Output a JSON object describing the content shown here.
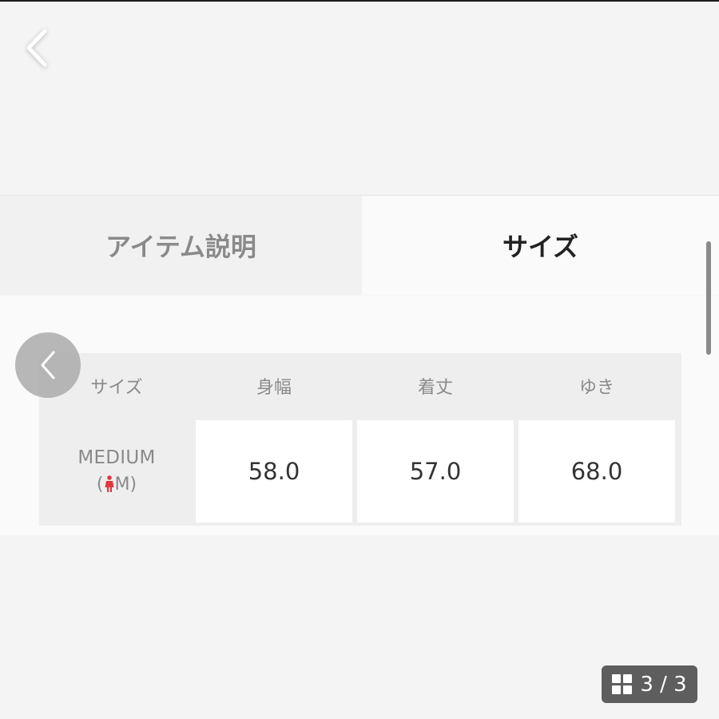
{
  "nav": {
    "back_icon": "chevron-left-icon"
  },
  "tabs": [
    {
      "label": "アイテム説明",
      "active": false
    },
    {
      "label": "サイズ",
      "active": true
    }
  ],
  "size_table": {
    "headers": [
      "サイズ",
      "身幅",
      "着丈",
      "ゆき"
    ],
    "rows": [
      {
        "size_name": "MEDIUM",
        "size_code_open": "(",
        "size_code_letter": "M",
        "size_code_close": ")",
        "gender_icon": "woman-figure-icon",
        "values": [
          "58.0",
          "57.0",
          "68.0"
        ]
      }
    ]
  },
  "gallery": {
    "prev_icon": "chevron-left-icon",
    "pager_icon": "grid-icon",
    "pager_label": "3 / 3"
  },
  "colors": {
    "accent_red": "#e0383e",
    "active_tab_text": "#222222",
    "inactive_tab_text": "#8a8a8a",
    "pager_bg": "#5e5e5e"
  }
}
